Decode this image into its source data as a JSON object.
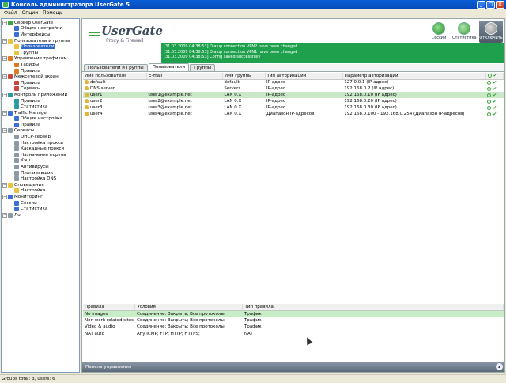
{
  "window": {
    "title": "Консоль администратора UserGate 5"
  },
  "menu": [
    "Файл",
    "Опции",
    "Помощь"
  ],
  "tree": [
    {
      "label": "Сервер UserGate",
      "level": 0,
      "icon": "green"
    },
    {
      "label": "Общие настройки",
      "level": 1,
      "icon": "blue"
    },
    {
      "label": "Интерфейсы",
      "level": 1,
      "icon": "blue"
    },
    {
      "label": "Пользователи и группы",
      "level": 0,
      "icon": "yellow"
    },
    {
      "label": "Пользователи",
      "level": 1,
      "icon": "yellow",
      "selected": true
    },
    {
      "label": "Группы",
      "level": 1,
      "icon": "yellow"
    },
    {
      "label": "Управление трафиком",
      "level": 0,
      "icon": "orange"
    },
    {
      "label": "Тарифы",
      "level": 1,
      "icon": "orange"
    },
    {
      "label": "Правила",
      "level": 1,
      "icon": "orange"
    },
    {
      "label": "Межсетевой экран",
      "level": 0,
      "icon": "red"
    },
    {
      "label": "Правила",
      "level": 1,
      "icon": "red"
    },
    {
      "label": "Сервисы",
      "level": 1,
      "icon": "red"
    },
    {
      "label": "Контроль приложений",
      "level": 0,
      "icon": "teal"
    },
    {
      "label": "Правила",
      "level": 1,
      "icon": "teal"
    },
    {
      "label": "Статистика",
      "level": 1,
      "icon": "teal"
    },
    {
      "label": "Traffic Manager",
      "level": 0,
      "icon": "blue"
    },
    {
      "label": "Общие настройки",
      "level": 1,
      "icon": "blue"
    },
    {
      "label": "Правила",
      "level": 1,
      "icon": "blue"
    },
    {
      "label": "Сервисы",
      "level": 0,
      "icon": "grey"
    },
    {
      "label": "DHCP-сервер",
      "level": 1,
      "icon": "grey"
    },
    {
      "label": "Настройка прокси",
      "level": 1,
      "icon": "grey"
    },
    {
      "label": "Каскадные прокси",
      "level": 1,
      "icon": "grey"
    },
    {
      "label": "Назначение портов",
      "level": 1,
      "icon": "grey"
    },
    {
      "label": "Кэш",
      "level": 1,
      "icon": "grey"
    },
    {
      "label": "Антивирусы",
      "level": 1,
      "icon": "grey"
    },
    {
      "label": "Планировщик",
      "level": 1,
      "icon": "grey"
    },
    {
      "label": "Настройка DNS",
      "level": 1,
      "icon": "grey"
    },
    {
      "label": "Оповещения",
      "level": 0,
      "icon": "yellow"
    },
    {
      "label": "Настройка",
      "level": 1,
      "icon": "yellow"
    },
    {
      "label": "Мониторинг",
      "level": 0,
      "icon": "blue"
    },
    {
      "label": "Сессии",
      "level": 1,
      "icon": "blue"
    },
    {
      "label": "Статистика",
      "level": 1,
      "icon": "blue"
    },
    {
      "label": "Лог",
      "level": 0,
      "icon": "grey"
    }
  ],
  "header": {
    "brand": "UserGate",
    "subtitle": "Proxy & Firewall",
    "buttons": {
      "sessions": "Сессии",
      "stats": "Статистика",
      "disconnect": "Отключить"
    },
    "status_lines": [
      "[31.03.2009 04:38:53] Dialup connection VPN2 have been changed",
      "[31.03.2009 04:38:53] Dialup connection VPN1 have been changed",
      "[31.03.2009 04:38:53] Config saved successfully"
    ]
  },
  "tabs": [
    "Пользователи и Группы",
    "Пользователи",
    "Группы"
  ],
  "users": {
    "columns": [
      "Имя пользователя",
      "E-mail",
      "Имя группы",
      "Тип авторизации",
      "Параметр авторизации"
    ],
    "rows": [
      {
        "name": "default",
        "email": "",
        "group": "default",
        "auth": "IP-адрес",
        "param": "127.0.0.1 (IP адрес)"
      },
      {
        "name": "DNS server",
        "email": "",
        "group": "Servers",
        "auth": "IP-адрес",
        "param": "192.168.0.2 (IP адрес)"
      },
      {
        "name": "user1",
        "email": "user1@example.net",
        "group": "LAN 0.X",
        "auth": "IP-адрес",
        "param": "192.168.0.10 (IP адрес)",
        "selected": true
      },
      {
        "name": "user2",
        "email": "user2@example.net",
        "group": "LAN 0.X",
        "auth": "IP-адрес",
        "param": "192.168.0.20 (IP адрес)"
      },
      {
        "name": "user3",
        "email": "user3@example.net",
        "group": "LAN 0.X",
        "auth": "IP-адрес",
        "param": "192.168.0.30 (IP адрес)"
      },
      {
        "name": "user4",
        "email": "user4@example.net",
        "group": "LAN 0.X",
        "auth": "Диапазон IP-адресов",
        "param": "192.168.0.100 - 192.168.0.254 (Диапазон IP-адресов)"
      }
    ]
  },
  "rules": {
    "columns": [
      "Правила",
      "Условия",
      "Тип правила"
    ],
    "rows": [
      {
        "name": "No images",
        "cond": "Соединение: Закрыть; Все протоколы",
        "type": "Трафик",
        "selected": true
      },
      {
        "name": "Non work-related sites",
        "cond": "Соединение: Закрыть; Все протоколы",
        "type": "Трафик"
      },
      {
        "name": "Video & audio",
        "cond": "Соединение: Закрыть; Все протоколы",
        "type": "Трафик"
      },
      {
        "name": "NAT auto",
        "cond": "Any ICMP; FTP; HTTP; HTTPS;",
        "type": "NAT"
      }
    ]
  },
  "panel": {
    "label": "Панель управления"
  },
  "status": "Groups total: 3, users: 6"
}
